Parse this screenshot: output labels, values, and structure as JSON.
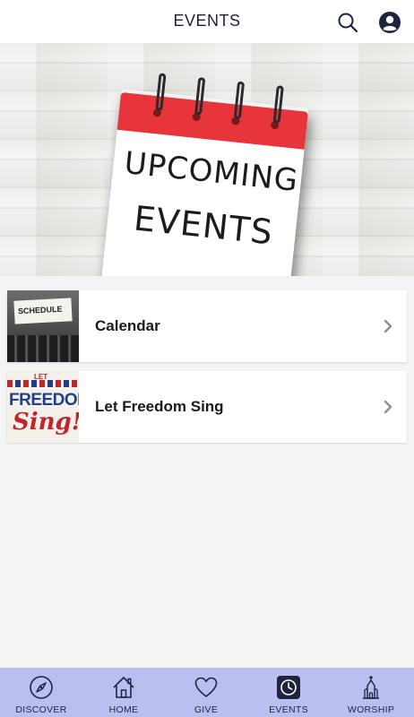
{
  "header": {
    "title": "EVENTS",
    "search_icon": "search-icon",
    "profile_icon": "profile-icon"
  },
  "hero": {
    "line1": "UPCOMING",
    "line2": "EVENTS"
  },
  "events": [
    {
      "label": "Calendar",
      "thumb_text": "SCHEDULE"
    },
    {
      "label": "Let Freedom Sing",
      "thumb_text_top": "LET",
      "thumb_text_mid": "FREEDOM",
      "thumb_text_bottom": "Sing!"
    }
  ],
  "tabs": [
    {
      "label": "DISCOVER",
      "icon": "compass-icon"
    },
    {
      "label": "HOME",
      "icon": "home-icon"
    },
    {
      "label": "GIVE",
      "icon": "heart-icon"
    },
    {
      "label": "EVENTS",
      "icon": "clock-icon"
    },
    {
      "label": "WORSHIP",
      "icon": "church-icon"
    }
  ],
  "colors": {
    "tab_bar": "#b9c0ef",
    "accent": "#1f2340",
    "calendar_red": "#e8353b"
  }
}
